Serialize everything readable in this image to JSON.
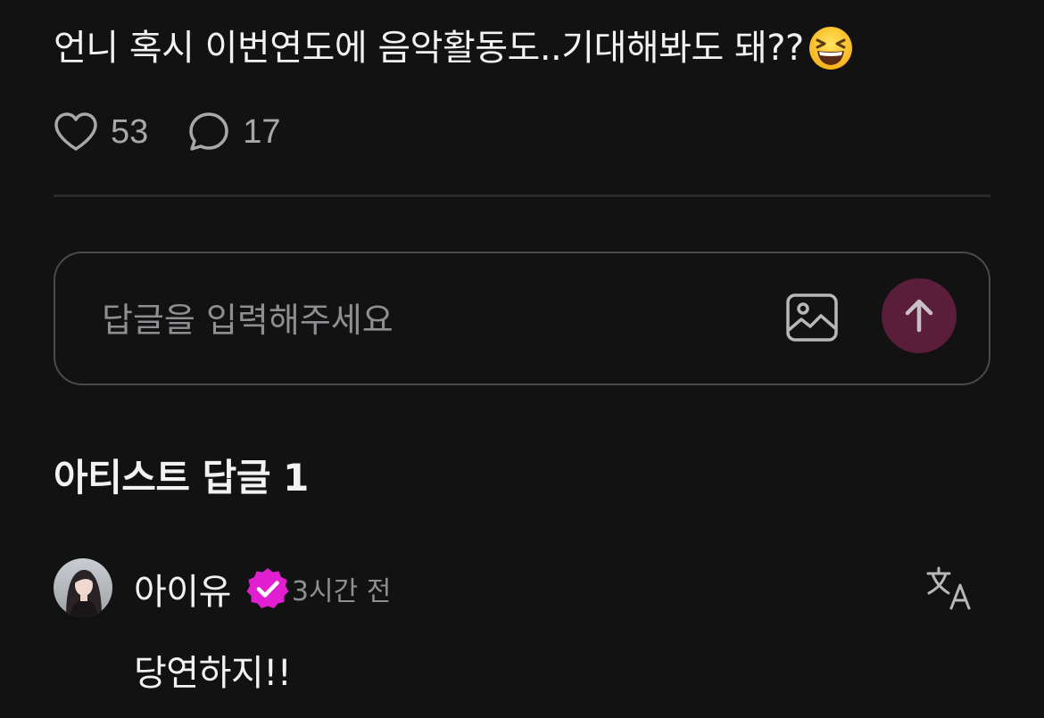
{
  "post": {
    "text": "언니 혹시 이번연도에 음악활동도..기대해봐도 돼??",
    "emoji": "grinning-squinting-face"
  },
  "actions": {
    "likes_count": "53",
    "comments_count": "17"
  },
  "reply": {
    "placeholder": "답글을 입력해주세요"
  },
  "artist_replies": {
    "title": "아티스트 답글 1"
  },
  "comment": {
    "author": "아이유",
    "timestamp": "3시간 전",
    "text": "당연하지!!"
  },
  "colors": {
    "background": "#121213",
    "send_button": "#5a1d3a",
    "verified_badge": "#e21fd0",
    "muted_text": "#8f8f93"
  },
  "icons": [
    "heart-icon",
    "comment-bubble-icon",
    "image-icon",
    "arrow-up-icon",
    "verified-badge-icon",
    "translate-icon"
  ]
}
